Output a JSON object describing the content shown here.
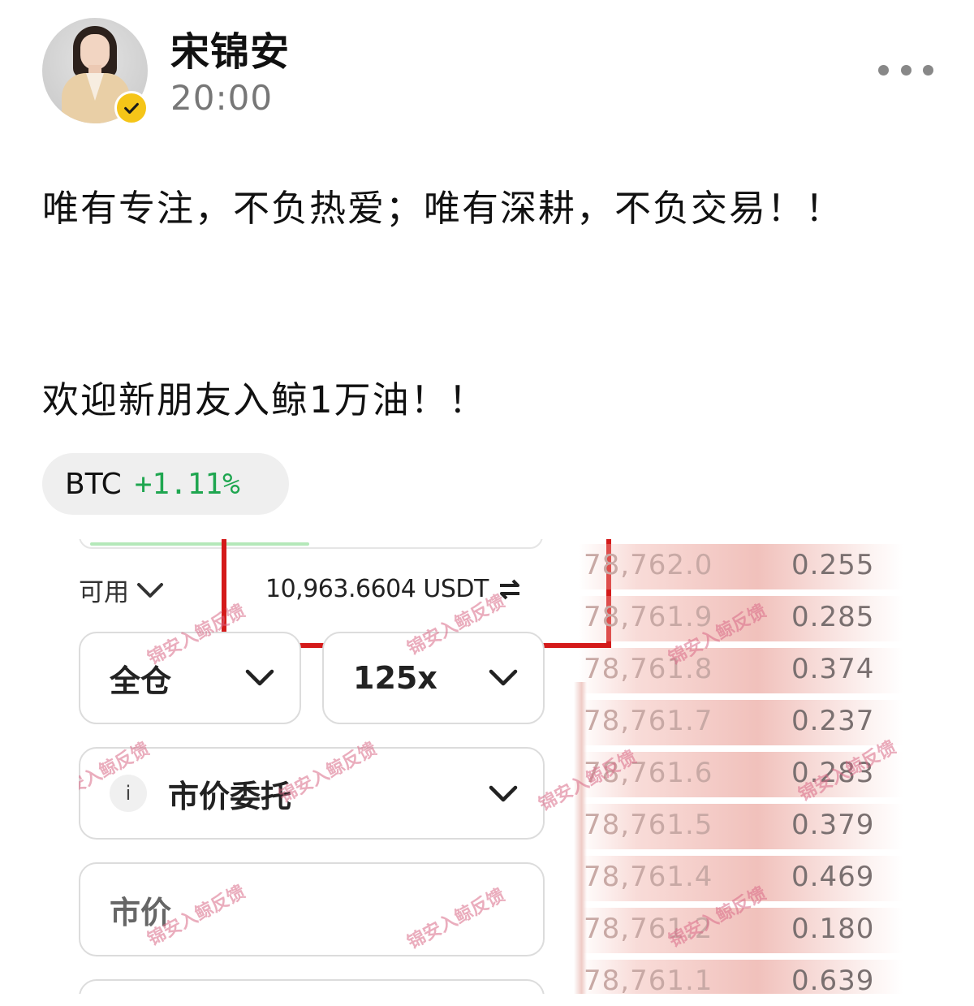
{
  "post": {
    "username": "宋锦安",
    "time": "20:00",
    "lines": [
      "唯有专注，不负热爱；唯有深耕，不负交易！！",
      "欢迎新朋友入鲸1万油！！"
    ],
    "ticker": {
      "symbol": "BTC",
      "change": "+1.11%"
    },
    "colors": {
      "positive": "#1fa650",
      "highlight_box": "#d41a1a",
      "badge": "#f5c518"
    }
  },
  "trade": {
    "available_label": "可用",
    "available_value": "10,963.6604 USDT",
    "margin_mode": "全仓",
    "leverage": "125x",
    "order_type": "市价委托",
    "info_glyph": "i",
    "price_placeholder": "市价",
    "watermark": "锦安入鲸反馈"
  },
  "orderbook": [
    {
      "price": "78,762.0",
      "qty": "0.255"
    },
    {
      "price": "78,761.9",
      "qty": "0.285"
    },
    {
      "price": "78,761.8",
      "qty": "0.374"
    },
    {
      "price": "78,761.7",
      "qty": "0.237"
    },
    {
      "price": "78,761.6",
      "qty": "0.283"
    },
    {
      "price": "78,761.5",
      "qty": "0.379"
    },
    {
      "price": "78,761.4",
      "qty": "0.469"
    },
    {
      "price": "78,761.2",
      "qty": "0.180"
    },
    {
      "price": "78,761.1",
      "qty": "0.639"
    }
  ],
  "icons": [
    "verified-icon",
    "more-icon",
    "chevron-down-icon",
    "swap-icon",
    "info-icon"
  ]
}
